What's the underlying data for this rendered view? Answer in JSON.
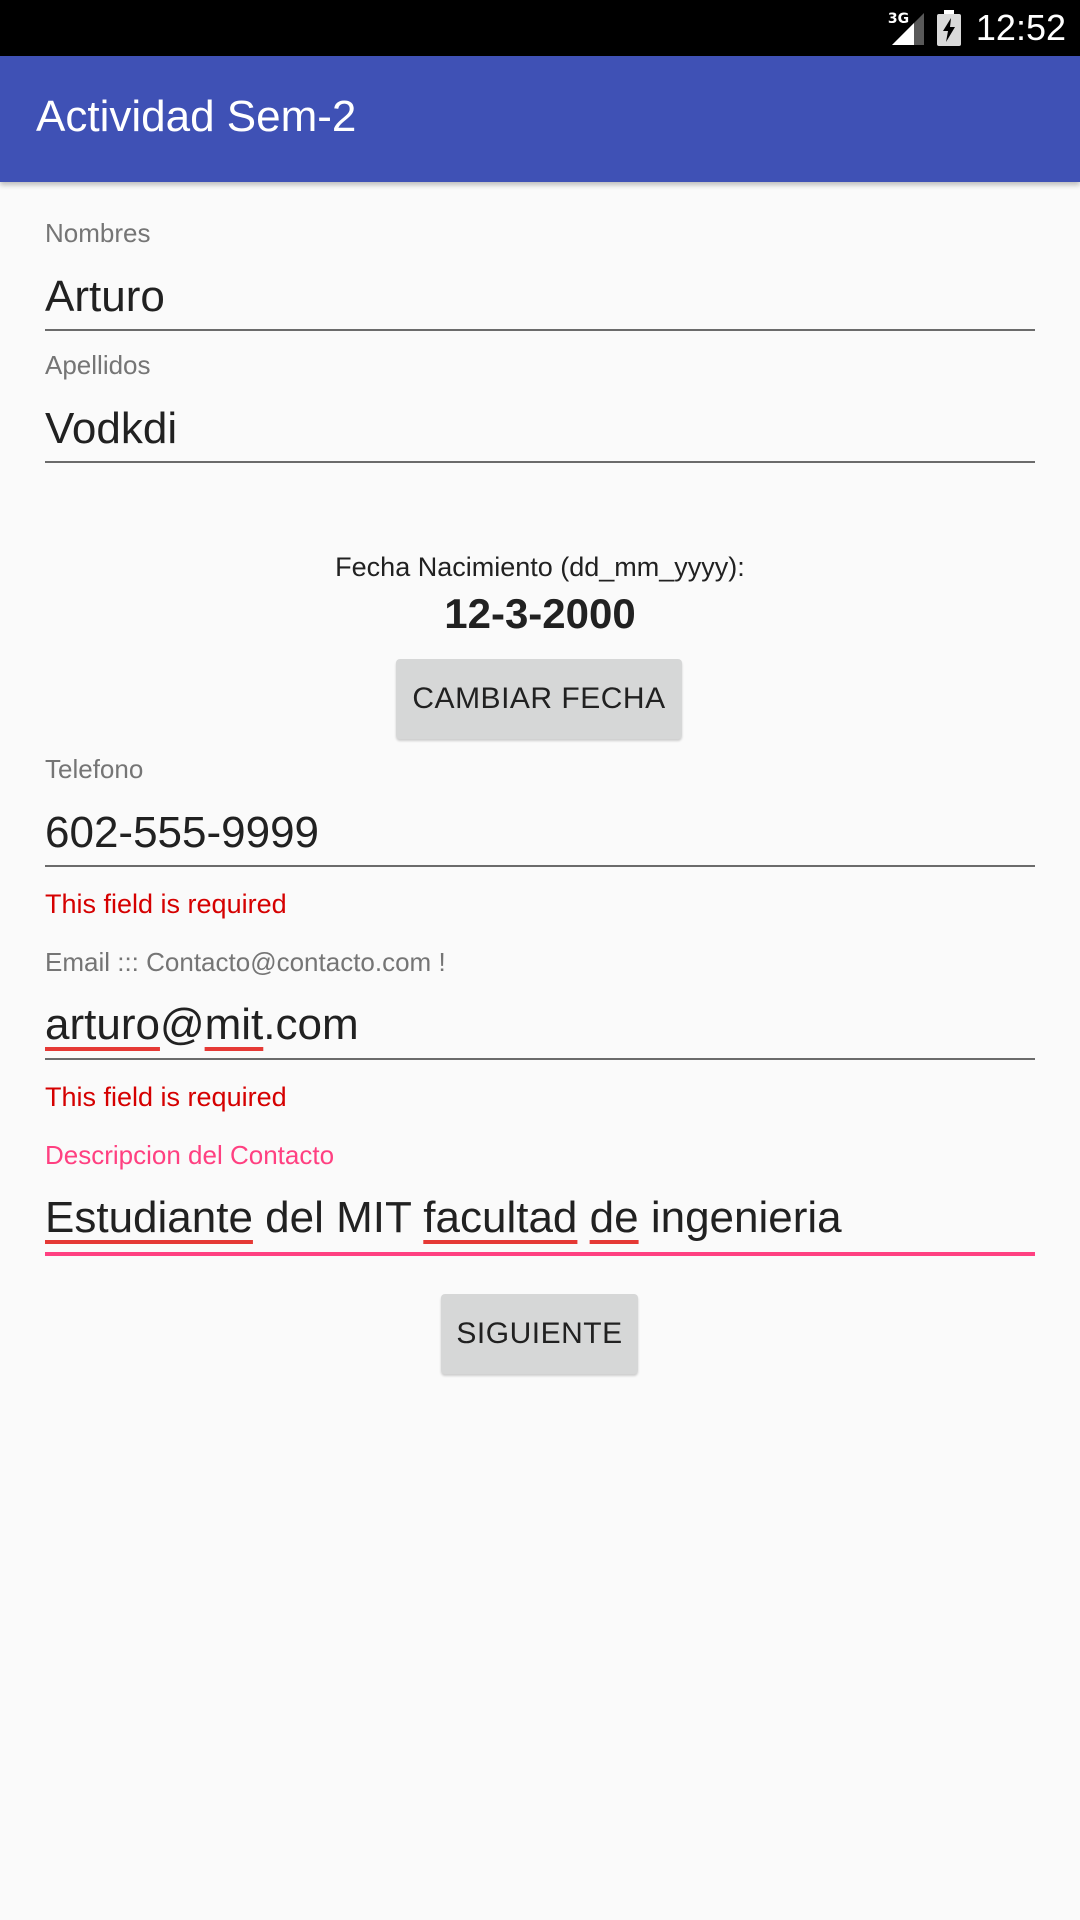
{
  "status_bar": {
    "network": "3G",
    "time": "12:52",
    "icons": [
      "signal-icon",
      "battery-charging-icon"
    ]
  },
  "app_bar": {
    "title": "Actividad Sem-2",
    "color": "#3f51b5"
  },
  "form": {
    "nombres": {
      "label": "Nombres",
      "value": "Arturo"
    },
    "apellidos": {
      "label": "Apellidos",
      "value": "Vodkdi"
    },
    "fecha": {
      "label": "Fecha Nacimiento (dd_mm_yyyy):",
      "value": "12-3-2000",
      "button": "CAMBIAR FECHA"
    },
    "telefono": {
      "label": "Telefono",
      "value": "602-555-9999",
      "error": "This field is required"
    },
    "email": {
      "label": "Email ::: Contacto@contacto.com !",
      "value_parts": [
        "arturo",
        "@",
        "mit",
        ".com"
      ],
      "error": "This field is required"
    },
    "descripcion": {
      "label": "Descripcion del Contacto",
      "value_parts": [
        "Estudiante",
        " del MIT ",
        "facultad",
        " ",
        "de",
        " ingenieria"
      ]
    },
    "siguiente_button": "SIGUIENTE"
  },
  "colors": {
    "accent": "#ff4081",
    "error": "#d50000",
    "button": "#d6d7d7"
  }
}
